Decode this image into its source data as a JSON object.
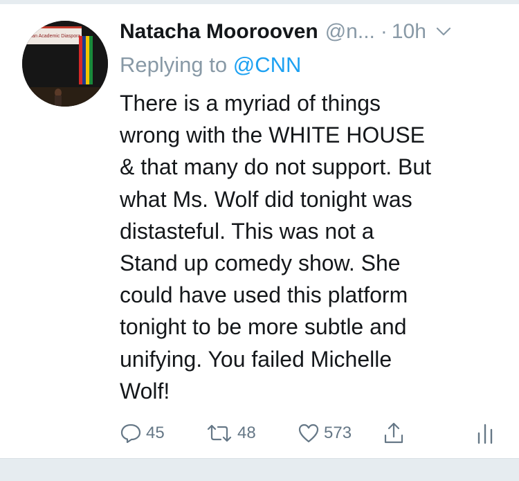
{
  "tweet": {
    "author_name": "Natacha Moorooven",
    "author_handle": "@n...",
    "separator": "·",
    "time": "10h",
    "reply_prefix": "Replying to",
    "reply_mention": "@CNN",
    "text_lines": [
      "There is a myriad of things",
      "wrong with the WHITE HOUSE",
      "& that many do not support. But",
      "what Ms. Wolf did tonight was",
      "distasteful. This was not a",
      "Stand up comedy show. She",
      "could have used this platform",
      "tonight to be more subtle and",
      "unifying. You failed Michelle",
      "Wolf!"
    ],
    "avatar_banner_text": "uritian Academic Diaspora"
  },
  "actions": {
    "reply_count": "45",
    "retweet_count": "48",
    "like_count": "573"
  },
  "icons": {
    "reply": "reply-icon",
    "retweet": "retweet-icon",
    "like": "heart-icon",
    "share": "share-icon",
    "analytics": "analytics-icon",
    "more": "chevron-down-icon"
  },
  "colors": {
    "text": "#14171a",
    "muted": "#8899a6",
    "link": "#1da1f2"
  }
}
